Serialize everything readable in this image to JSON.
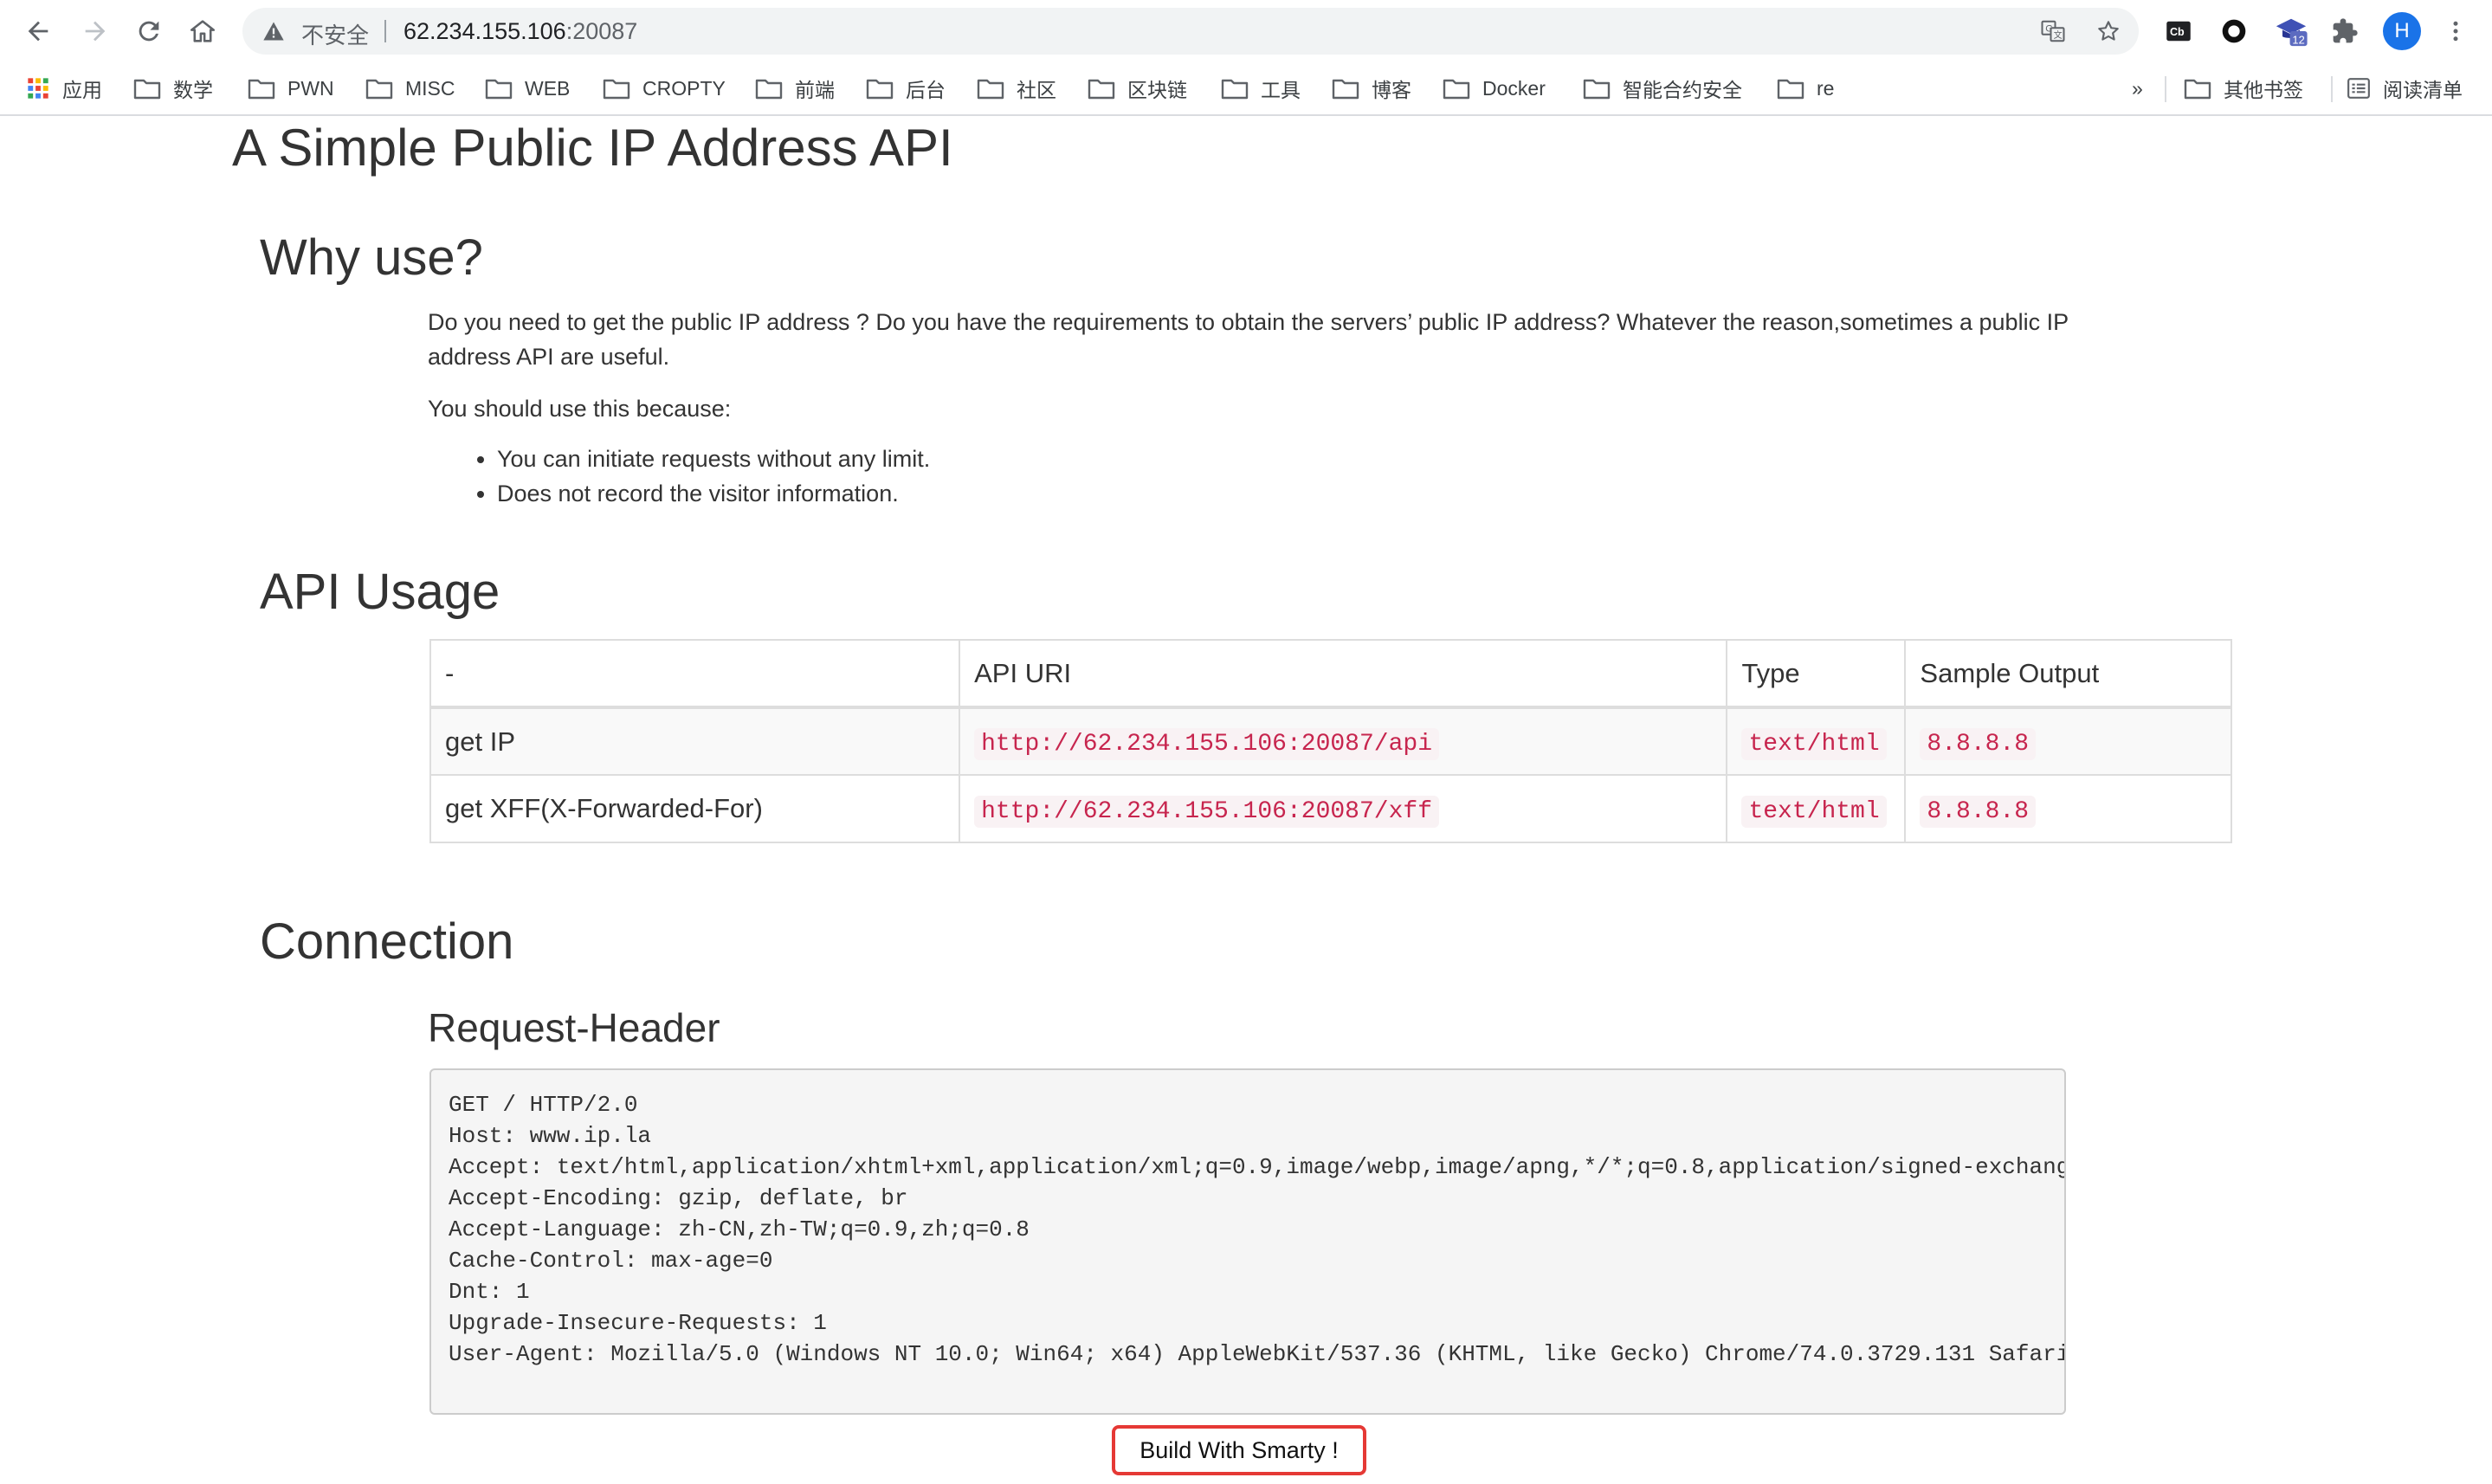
{
  "browser": {
    "security_label": "不安全",
    "url_host": "62.234.155.106",
    "url_port": ":20087",
    "extensions": [
      "translate-icon",
      "star-icon",
      "cb-extension-icon",
      "circle-extension-icon",
      "grad-cap-extension-icon",
      "puzzle-icon"
    ],
    "extension_badge": "12",
    "profile_initial": "H",
    "bookmarks": [
      {
        "label": "应用",
        "kind": "apps"
      },
      {
        "label": "数学"
      },
      {
        "label": "PWN"
      },
      {
        "label": "MISC"
      },
      {
        "label": "WEB"
      },
      {
        "label": "CROPTY"
      },
      {
        "label": "前端"
      },
      {
        "label": "后台"
      },
      {
        "label": "社区"
      },
      {
        "label": "区块链"
      },
      {
        "label": "工具"
      },
      {
        "label": "博客"
      },
      {
        "label": "Docker"
      },
      {
        "label": "智能合约安全"
      },
      {
        "label": "re"
      }
    ],
    "overflow": "»",
    "other_bookmarks": "其他书签",
    "reading_list": "阅读清单"
  },
  "page": {
    "title": "A Simple Public IP Address API",
    "why": {
      "heading": "Why use?",
      "intro": "Do you need to get the public IP address ? Do you have the requirements to obtain the servers’ public IP address? Whatever the reason,sometimes a public IP address API are useful.",
      "lead": "You should use this because:",
      "reasons": [
        "You can initiate requests without any limit.",
        "Does not record the visitor information."
      ]
    },
    "usage": {
      "heading": "API Usage",
      "columns": [
        "-",
        "API URI",
        "Type",
        "Sample Output"
      ],
      "rows": [
        {
          "name": "get IP",
          "uri": "http://62.234.155.106:20087/api",
          "type": "text/html",
          "sample": "8.8.8.8"
        },
        {
          "name": "get XFF(X-Forwarded-For)",
          "uri": "http://62.234.155.106:20087/xff",
          "type": "text/html",
          "sample": "8.8.8.8"
        }
      ]
    },
    "connection": {
      "heading": "Connection",
      "subheading": "Request-Header",
      "headers": "GET / HTTP/2.0\nHost: www.ip.la\nAccept: text/html,application/xhtml+xml,application/xml;q=0.9,image/webp,image/apng,*/*;q=0.8,application/signed-exchang\nAccept-Encoding: gzip, deflate, br\nAccept-Language: zh-CN,zh-TW;q=0.9,zh;q=0.8\nCache-Control: max-age=0\nDnt: 1\nUpgrade-Insecure-Requests: 1\nUser-Agent: Mozilla/5.0 (Windows NT 10.0; Win64; x64) AppleWebKit/537.36 (KHTML, like Gecko) Chrome/74.0.3729.131 Safari"
    },
    "footer_button": "Build With Smarty !"
  }
}
